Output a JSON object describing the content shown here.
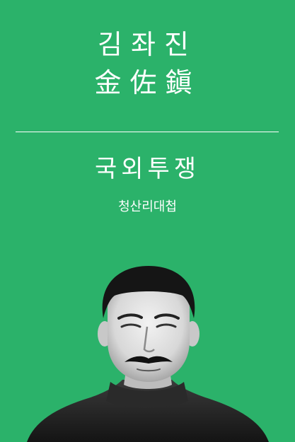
{
  "colors": {
    "background": "#2bb26a",
    "text": "#ffffff"
  },
  "person": {
    "name_hangul": "김좌진",
    "name_hanja": "金佐鎭"
  },
  "category": "국외투쟁",
  "event": "청산리대첩",
  "portrait": {
    "icon": "black-and-white-portrait"
  }
}
